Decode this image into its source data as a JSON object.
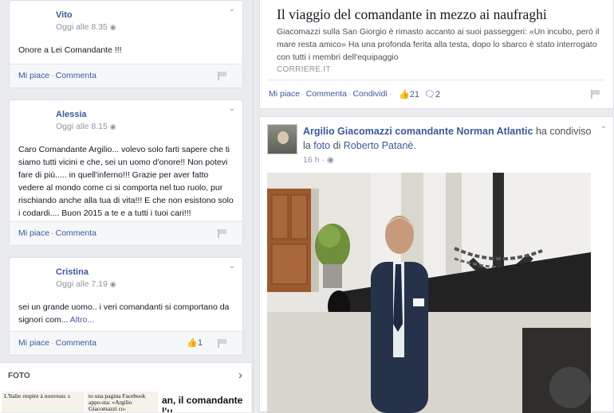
{
  "comments": [
    {
      "author": "Vito",
      "time": "Oggi alle 8.35",
      "text": "Onore a Lei Comandante !!!",
      "more": "",
      "like_label": "Mi piace",
      "comment_label": "Commenta",
      "like_count": ""
    },
    {
      "author": "Alessia",
      "time": "Oggi alle 8.15",
      "text": "Caro Comandante Argilio... volevo solo farti sapere che ti siamo tutti vicini e che, sei un uomo d'onore!! Non potevi fare di più..... in quell'inferno!!! Grazie per aver fatto vedere al mondo come ci si comporta nel tuo ruolo, pur rischiando anche alla tua di vita!!! E che non esistono solo i codardi.... Buon 2015 a te e a tutti i tuoi cari!!!",
      "more": "",
      "like_label": "Mi piace",
      "comment_label": "Commenta",
      "like_count": ""
    },
    {
      "author": "Cristina",
      "time": "Oggi alle 7.19",
      "text": "sei un grande uomo.. i veri comandanti si comportano da signori com...",
      "more": "Altro...",
      "like_label": "Mi piace",
      "comment_label": "Commenta",
      "like_count": "1"
    }
  ],
  "foto_section": {
    "label": "FOTO",
    "arrow": "›",
    "thumbs": [
      "L'Italie respire à nouveau: s",
      "to una pagina Facebook appo-sta: «Argilio Giacomazzi co-",
      "an, il comandante l'u"
    ]
  },
  "link_card": {
    "headline": "Il viaggio del comandante in mezzo ai naufraghi",
    "description": "Giacomazzi sulla San Giorgio è rimasto accanto ai suoi passeggeri: «Un incubo, però il mare resta amico» Ha una profonda ferita alla testa, dopo lo sbarco è stato interrogato con tutti i membri dell'equipaggio",
    "source": "CORRIERE.IT",
    "like_label": "Mi piace",
    "comment_label": "Commenta",
    "share_label": "Condividi",
    "likes": "21",
    "comments": "2"
  },
  "post": {
    "author": "Argilio Giacomazzi comandante Norman Atlantic",
    "shared_text": "ha condiviso la",
    "photo_word": "foto",
    "of_text": "di",
    "photo_owner": "Roberto Patanè.",
    "time": "16 h"
  },
  "colors": {
    "link": "#3b5998",
    "muted": "#90949c",
    "background": "#e9ebee"
  }
}
